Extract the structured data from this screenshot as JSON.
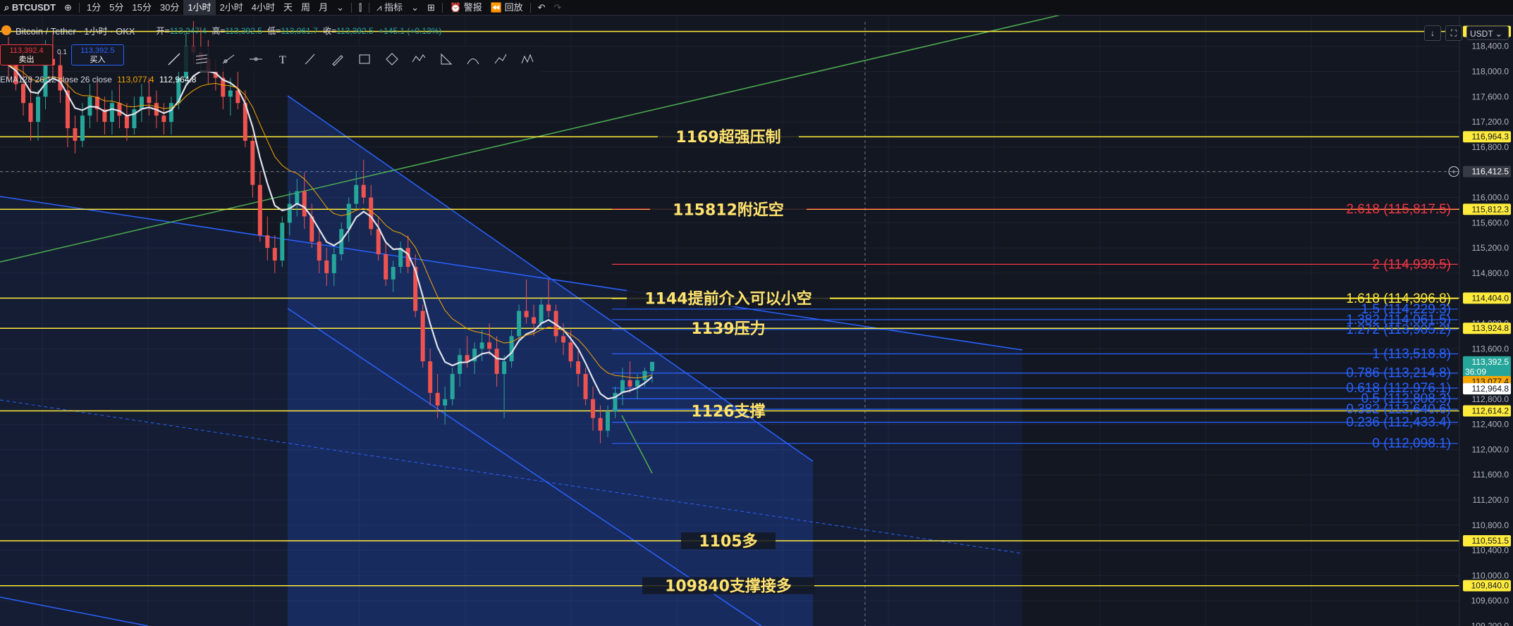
{
  "topbar": {
    "symbol": "BTCUSDT",
    "intervals": [
      "1分",
      "5分",
      "15分",
      "30分",
      "1小时",
      "2小时",
      "4小时",
      "天",
      "周",
      "月"
    ],
    "active_interval": "1小时",
    "indicators_label": "指标",
    "alert_label": "警报",
    "replay_label": "回放"
  },
  "legend": {
    "title": "Bitcoin / Tether · 1小时 · OKX",
    "open_label": "开=",
    "open": "113,247.4",
    "high_label": "高=",
    "high": "113,392.5",
    "low_label": "低=",
    "low": "113,061.7",
    "close_label": "收=",
    "close": "113,392.5",
    "change": "+145.1 (+0.13%)"
  },
  "trade": {
    "sell_price": "113,392.4",
    "sell_label": "卖出",
    "spread": "0.1",
    "buy_price": "113,392.5",
    "buy_label": "买入"
  },
  "ema": {
    "label": "EMA128 26 12 close 26 close",
    "v1": "113,077.4",
    "v2": "112,964.8"
  },
  "topright": {
    "unit": "USDT"
  },
  "colors": {
    "bg": "#131722",
    "up": "#26a69a",
    "down": "#ef5350",
    "blue": "#2962ff",
    "yellow": "#ffeb3b",
    "green_trend": "#4caf50",
    "red_fib": "#f23645"
  },
  "chart_data": {
    "type": "candlestick",
    "symbol": "BTCUSDT",
    "interval": "1小时",
    "y_axis": {
      "range": [
        109200,
        118900
      ],
      "ticks": [
        109200,
        109600,
        110000,
        110400,
        110800,
        111200,
        111600,
        112000,
        112400,
        112800,
        113200,
        113600,
        114000,
        114400,
        114800,
        115200,
        115600,
        116000,
        116400,
        116800,
        117200,
        117600,
        118000,
        118400
      ],
      "tick_labels": [
        "109,200.0",
        "109,600.0",
        "110,000.0",
        "110,400.0",
        "110,800.0",
        "111,200.0",
        "111,600.0",
        "112,000.0",
        "112,400.0",
        "112,800.0",
        "113,200.0",
        "113,600.0",
        "114,000.0",
        "114,400.0",
        "114,800.0",
        "115,200.0",
        "115,600.0",
        "116,000.0",
        "116,400.0",
        "116,800.0",
        "117,200.0",
        "117,600.0",
        "118,000.0",
        "118,400.0"
      ],
      "tags": [
        {
          "value": 118636.3,
          "label": "118,636.3",
          "style": "yellow"
        },
        {
          "value": 116964.3,
          "label": "116,964.3",
          "style": "yellow"
        },
        {
          "value": 116412.5,
          "label": "116,412.5",
          "style": "cursor"
        },
        {
          "value": 115812.3,
          "label": "115,812.3",
          "style": "yellow"
        },
        {
          "value": 114404.0,
          "label": "114,404.0",
          "style": "yellow"
        },
        {
          "value": 113924.8,
          "label": "113,924.8",
          "style": "yellow"
        },
        {
          "value": 113392.5,
          "label": "113,392.5",
          "style": "last",
          "sub": "36:09"
        },
        {
          "value": 113077.4,
          "label": "113,077.4",
          "style": "orange"
        },
        {
          "value": 112964.8,
          "label": "112,964.8",
          "style": "white"
        },
        {
          "value": 112614.2,
          "label": "112,614.2",
          "style": "yellow"
        },
        {
          "value": 110551.5,
          "label": "110,551.5",
          "style": "yellow"
        },
        {
          "value": 109840.0,
          "label": "109,840.0",
          "style": "yellow"
        }
      ]
    },
    "horizontal_levels": [
      {
        "value": 118636.3,
        "label": ""
      },
      {
        "value": 116964.3,
        "label": "1169超强压制"
      },
      {
        "value": 115812.3,
        "label": "115812附近空"
      },
      {
        "value": 114404.0,
        "label": "1144提前介入可以小空"
      },
      {
        "value": 113924.8,
        "label": "1139压力"
      },
      {
        "value": 112614.2,
        "label": "1126支撑"
      },
      {
        "value": 110551.5,
        "label": "1105多"
      },
      {
        "value": 109840.0,
        "label": "109840支撑接多"
      }
    ],
    "fib_levels": [
      {
        "ratio": "2.618",
        "value": 115817.5,
        "label": "2.618 (115,817.5)",
        "color": "red"
      },
      {
        "ratio": "2",
        "value": 114939.5,
        "label": "2 (114,939.5)",
        "color": "red"
      },
      {
        "ratio": "1.618",
        "value": 114396.8,
        "label": "1.618 (114,396.8)",
        "color": "yellow"
      },
      {
        "ratio": "1.5",
        "value": 114229.3,
        "label": "1.5 (114,229.3)",
        "color": "blue"
      },
      {
        "ratio": "1.382",
        "value": 114061.5,
        "label": "1.382 (114,061.5)",
        "color": "blue"
      },
      {
        "ratio": "1.272",
        "value": 113905.2,
        "label": "1.272 (113,905.2)",
        "color": "blue"
      },
      {
        "ratio": "1",
        "value": 113518.8,
        "label": "1 (113,518.8)",
        "color": "blue"
      },
      {
        "ratio": "0.786",
        "value": 113214.8,
        "label": "0.786 (113,214.8)",
        "color": "blue"
      },
      {
        "ratio": "0.618",
        "value": 112976.1,
        "label": "0.618 (112,976.1)",
        "color": "blue"
      },
      {
        "ratio": "0.5",
        "value": 112808.3,
        "label": "0.5 (112,808.3)",
        "color": "blue"
      },
      {
        "ratio": "0.382",
        "value": 112640.6,
        "label": "0.382 (112,640.6)",
        "color": "blue"
      },
      {
        "ratio": "0.236",
        "value": 112433.4,
        "label": "0.236 (112,433.4)",
        "color": "blue"
      },
      {
        "ratio": "0",
        "value": 112098.1,
        "label": "0 (112,098.1)",
        "color": "blue"
      }
    ],
    "last_price": 113392.5,
    "ema_values": [
      113077.4,
      112964.8
    ],
    "candles": [
      [
        118300,
        118550,
        117850,
        118100
      ],
      [
        118100,
        118400,
        117700,
        117800
      ],
      [
        117800,
        118200,
        117300,
        117500
      ],
      [
        117500,
        117900,
        116900,
        117200
      ],
      [
        117200,
        117700,
        116900,
        117600
      ],
      [
        117600,
        118500,
        117400,
        118200
      ],
      [
        118200,
        118600,
        117900,
        118100
      ],
      [
        118100,
        118300,
        117500,
        117700
      ],
      [
        117700,
        117900,
        116800,
        117100
      ],
      [
        117100,
        117300,
        116700,
        116900
      ],
      [
        116900,
        117500,
        116800,
        117300
      ],
      [
        117300,
        117800,
        117100,
        117600
      ],
      [
        117600,
        117900,
        117200,
        117400
      ],
      [
        117400,
        117600,
        117000,
        117200
      ],
      [
        117200,
        117700,
        117000,
        117500
      ],
      [
        117500,
        117800,
        117100,
        117300
      ],
      [
        117300,
        117500,
        116900,
        117100
      ],
      [
        117100,
        117600,
        117000,
        117400
      ],
      [
        117400,
        117800,
        117200,
        117600
      ],
      [
        117600,
        117900,
        117300,
        117500
      ],
      [
        117500,
        117700,
        117100,
        117300
      ],
      [
        117300,
        117500,
        117000,
        117200
      ],
      [
        117200,
        117600,
        117000,
        117500
      ],
      [
        117500,
        118000,
        117400,
        117900
      ],
      [
        117900,
        118600,
        117800,
        118400
      ],
      [
        118400,
        118800,
        118100,
        118300
      ],
      [
        118300,
        118700,
        118000,
        118200
      ],
      [
        118200,
        118500,
        117800,
        118000
      ],
      [
        118000,
        118200,
        117700,
        117900
      ],
      [
        117900,
        118100,
        117400,
        117600
      ],
      [
        117600,
        117900,
        117300,
        117700
      ],
      [
        117700,
        118000,
        117400,
        117500
      ],
      [
        117500,
        117700,
        116800,
        116900
      ],
      [
        116900,
        117000,
        116000,
        116200
      ],
      [
        116200,
        116400,
        115300,
        115400
      ],
      [
        115400,
        115700,
        115000,
        115200
      ],
      [
        115200,
        115400,
        114800,
        115000
      ],
      [
        115000,
        115700,
        114900,
        115600
      ],
      [
        115600,
        116100,
        115400,
        115900
      ],
      [
        115900,
        116300,
        115700,
        116100
      ],
      [
        116100,
        116400,
        115500,
        115700
      ],
      [
        115700,
        115900,
        115200,
        115300
      ],
      [
        115300,
        115500,
        114800,
        115000
      ],
      [
        115000,
        115200,
        114600,
        114800
      ],
      [
        114800,
        115200,
        114600,
        115100
      ],
      [
        115100,
        115600,
        115000,
        115500
      ],
      [
        115500,
        116000,
        115300,
        115900
      ],
      [
        115900,
        116400,
        115800,
        116200
      ],
      [
        116200,
        116600,
        115900,
        116000
      ],
      [
        116000,
        116200,
        115400,
        115500
      ],
      [
        115500,
        115700,
        115000,
        115100
      ],
      [
        115100,
        115300,
        114600,
        114700
      ],
      [
        114700,
        115000,
        114500,
        114900
      ],
      [
        114900,
        115300,
        114800,
        115200
      ],
      [
        115200,
        115400,
        114800,
        114900
      ],
      [
        114900,
        115100,
        114100,
        114200
      ],
      [
        114200,
        114300,
        113300,
        113400
      ],
      [
        113400,
        113600,
        112700,
        112900
      ],
      [
        112900,
        113200,
        112500,
        112700
      ],
      [
        112700,
        113000,
        112400,
        112800
      ],
      [
        112800,
        113300,
        112700,
        113200
      ],
      [
        113200,
        113600,
        113000,
        113500
      ],
      [
        113500,
        113800,
        113300,
        113400
      ],
      [
        113400,
        113700,
        113200,
        113600
      ],
      [
        113600,
        113900,
        113400,
        113700
      ],
      [
        113700,
        114000,
        113500,
        113600
      ],
      [
        113600,
        113800,
        113000,
        113200
      ],
      [
        113200,
        113500,
        112500,
        113400
      ],
      [
        113400,
        113900,
        113300,
        113800
      ],
      [
        113800,
        114300,
        113700,
        114200
      ],
      [
        114200,
        114700,
        114000,
        114100
      ],
      [
        114100,
        114300,
        113800,
        114000
      ],
      [
        114000,
        114400,
        113900,
        114300
      ],
      [
        114300,
        114700,
        114100,
        114200
      ],
      [
        114200,
        114300,
        113700,
        113800
      ],
      [
        113800,
        114000,
        113500,
        113700
      ],
      [
        113700,
        113900,
        113300,
        113400
      ],
      [
        113400,
        113600,
        113000,
        113200
      ],
      [
        113200,
        113300,
        112700,
        112800
      ],
      [
        112800,
        113000,
        112300,
        112500
      ],
      [
        112500,
        112700,
        112100,
        112300
      ],
      [
        112300,
        112700,
        112200,
        112600
      ],
      [
        112600,
        113000,
        112500,
        112900
      ],
      [
        112900,
        113300,
        112700,
        113100
      ],
      [
        113100,
        113400,
        112900,
        113000
      ],
      [
        113000,
        113200,
        112800,
        113100
      ],
      [
        113100,
        113300,
        113000,
        113247
      ],
      [
        113247,
        113392,
        113061,
        113392
      ]
    ]
  }
}
